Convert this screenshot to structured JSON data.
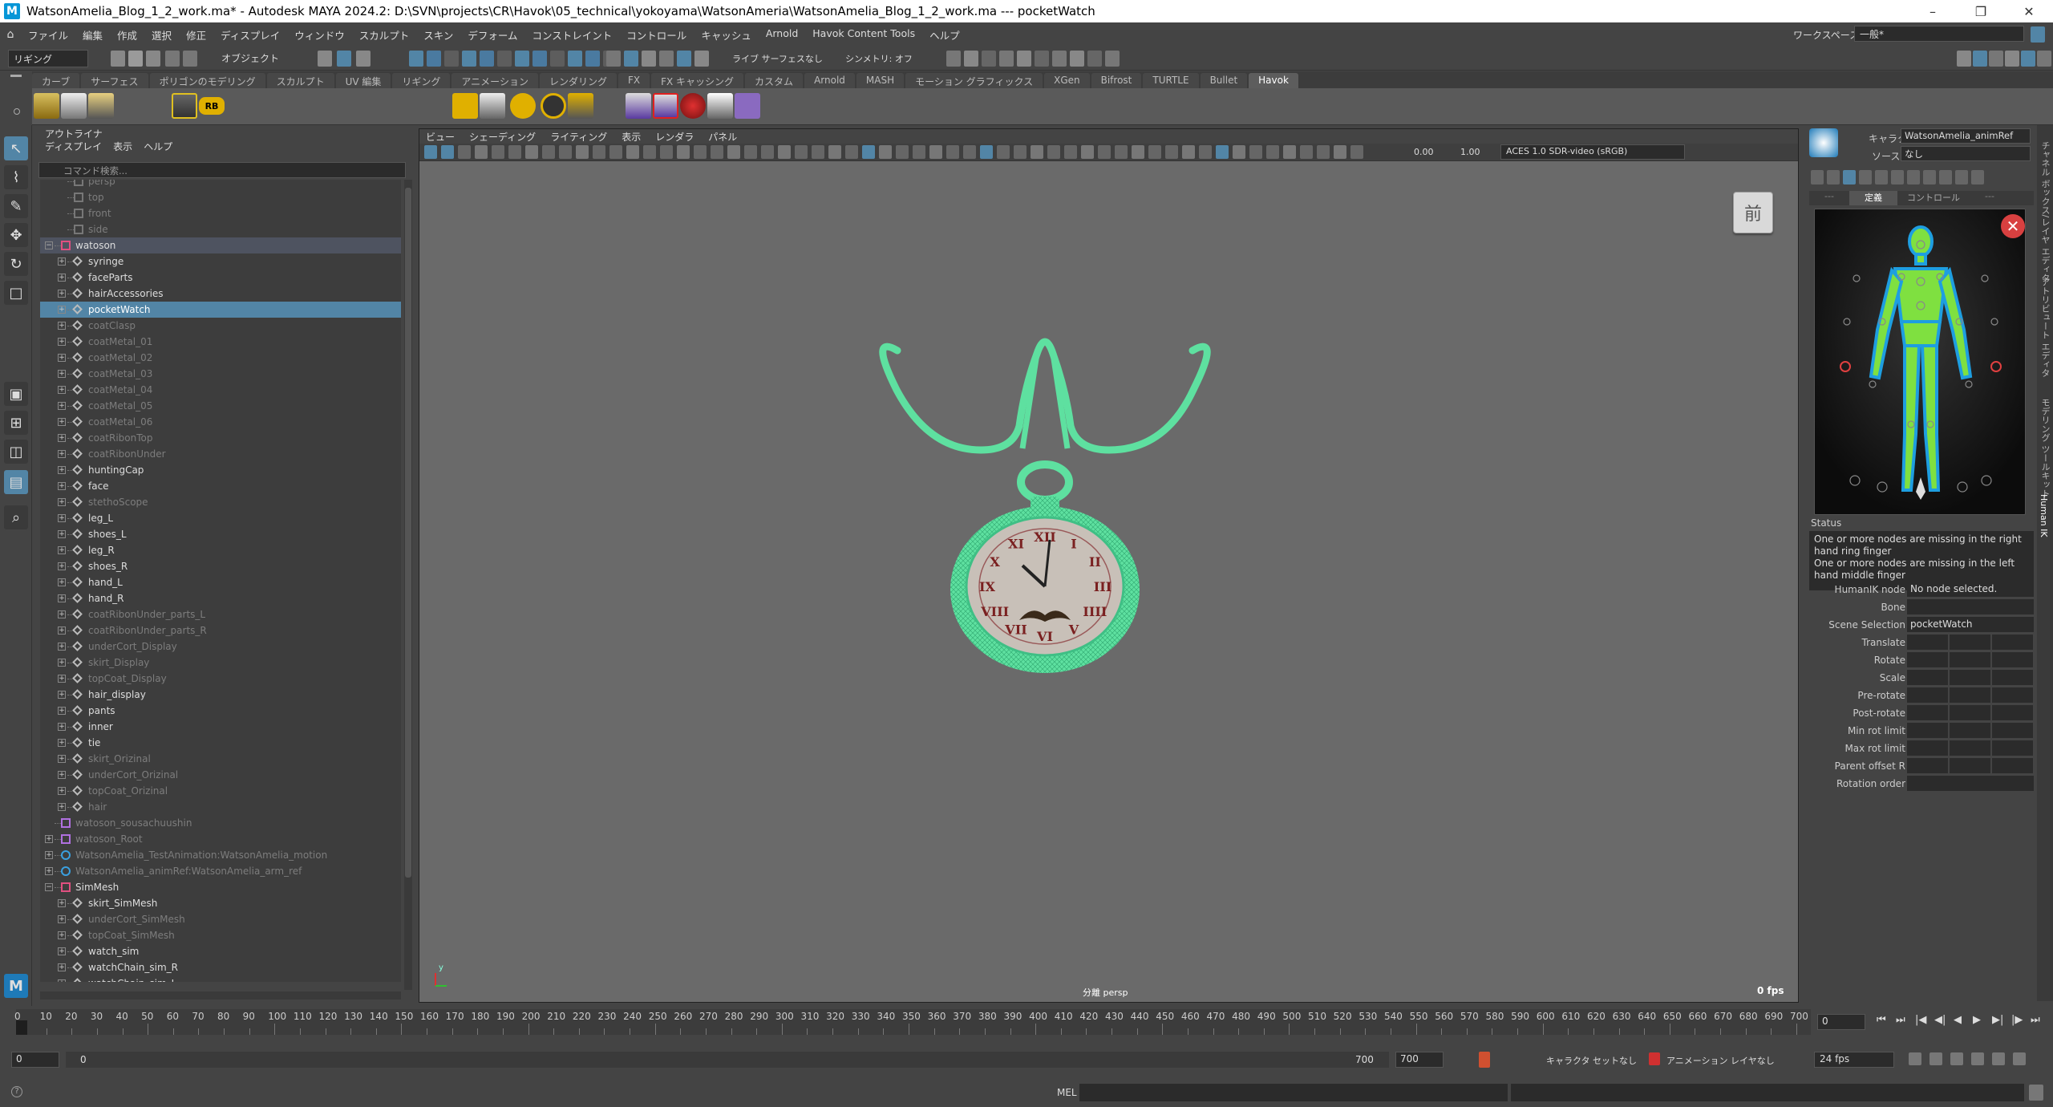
{
  "title_bar": {
    "text": "WatsonAmelia_Blog_1_2_work.ma* - Autodesk MAYA 2024.2: D:\\SVN\\projects\\CR\\Havok\\05_technical\\yokoyama\\WatsonAmeria\\WatsonAmelia_Blog_1_2_work.ma  ---  pocketWatch",
    "app_logo": "M",
    "minimize": "–",
    "restore": "❐",
    "close": "✕"
  },
  "menus": [
    "ファイル",
    "編集",
    "作成",
    "選択",
    "修正",
    "ディスプレイ",
    "ウィンドウ",
    "スカルプト",
    "スキン",
    "デフォーム",
    "コンストレイント",
    "コントロール",
    "キャッシュ",
    "Arnold",
    "Havok Content Tools",
    "ヘルプ"
  ],
  "workspace": {
    "label": "ワークスペース:",
    "value": "一般*"
  },
  "status_line": {
    "menuset": "リギング",
    "mode": "オブジェクト",
    "live": "ライブ サーフェスなし",
    "symmetry": "シンメトリ: オフ"
  },
  "shelf_tabs": [
    "カーブ",
    "サーフェス",
    "ポリゴンのモデリング",
    "スカルプト",
    "UV 編集",
    "リギング",
    "アニメーション",
    "レンダリング",
    "FX",
    "FX キャッシング",
    "カスタム",
    "Arnold",
    "MASH",
    "モーション グラフィックス",
    "XGen",
    "Bifrost",
    "TURTLE",
    "Bullet",
    "Havok"
  ],
  "shelf_active": "Havok",
  "outliner": {
    "title": "アウトライナ",
    "menu": [
      "ディスプレイ",
      "表示",
      "ヘルプ"
    ],
    "search_placeholder": "コマンド検索...",
    "items": [
      {
        "label": "persp",
        "level": 1,
        "dim": true,
        "type": "cam"
      },
      {
        "label": "top",
        "level": 1,
        "dim": true,
        "type": "cam"
      },
      {
        "label": "front",
        "level": 1,
        "dim": true,
        "type": "cam"
      },
      {
        "label": "side",
        "level": 1,
        "dim": true,
        "type": "cam"
      },
      {
        "label": "watoson",
        "level": 0,
        "exp": "minus",
        "type": "ref",
        "group": true
      },
      {
        "label": "syringe",
        "level": 1,
        "exp": "plus",
        "type": "mesh"
      },
      {
        "label": "faceParts",
        "level": 1,
        "exp": "plus",
        "type": "mesh"
      },
      {
        "label": "hairAccessories",
        "level": 1,
        "exp": "plus",
        "type": "mesh"
      },
      {
        "label": "pocketWatch",
        "level": 1,
        "exp": "plus",
        "type": "mesh",
        "selected": true
      },
      {
        "label": "coatClasp",
        "level": 1,
        "exp": "plus",
        "type": "mesh",
        "dim": true
      },
      {
        "label": "coatMetal_01",
        "level": 1,
        "exp": "plus",
        "type": "mesh",
        "dim": true
      },
      {
        "label": "coatMetal_02",
        "level": 1,
        "exp": "plus",
        "type": "mesh",
        "dim": true
      },
      {
        "label": "coatMetal_03",
        "level": 1,
        "exp": "plus",
        "type": "mesh",
        "dim": true
      },
      {
        "label": "coatMetal_04",
        "level": 1,
        "exp": "plus",
        "type": "mesh",
        "dim": true
      },
      {
        "label": "coatMetal_05",
        "level": 1,
        "exp": "plus",
        "type": "mesh",
        "dim": true
      },
      {
        "label": "coatMetal_06",
        "level": 1,
        "exp": "plus",
        "type": "mesh",
        "dim": true
      },
      {
        "label": "coatRibonTop",
        "level": 1,
        "exp": "plus",
        "type": "mesh",
        "dim": true
      },
      {
        "label": "coatRibonUnder",
        "level": 1,
        "exp": "plus",
        "type": "mesh",
        "dim": true
      },
      {
        "label": "huntingCap",
        "level": 1,
        "exp": "plus",
        "type": "mesh"
      },
      {
        "label": "face",
        "level": 1,
        "exp": "plus",
        "type": "mesh"
      },
      {
        "label": "stethoScope",
        "level": 1,
        "exp": "plus",
        "type": "mesh",
        "dim": true
      },
      {
        "label": "leg_L",
        "level": 1,
        "exp": "plus",
        "type": "mesh"
      },
      {
        "label": "shoes_L",
        "level": 1,
        "exp": "plus",
        "type": "mesh"
      },
      {
        "label": "leg_R",
        "level": 1,
        "exp": "plus",
        "type": "mesh"
      },
      {
        "label": "shoes_R",
        "level": 1,
        "exp": "plus",
        "type": "mesh"
      },
      {
        "label": "hand_L",
        "level": 1,
        "exp": "plus",
        "type": "mesh"
      },
      {
        "label": "hand_R",
        "level": 1,
        "exp": "plus",
        "type": "mesh"
      },
      {
        "label": "coatRibonUnder_parts_L",
        "level": 1,
        "exp": "plus",
        "type": "mesh",
        "dim": true
      },
      {
        "label": "coatRibonUnder_parts_R",
        "level": 1,
        "exp": "plus",
        "type": "mesh",
        "dim": true
      },
      {
        "label": "underCort_Display",
        "level": 1,
        "exp": "plus",
        "type": "mesh",
        "dim": true
      },
      {
        "label": "skirt_Display",
        "level": 1,
        "exp": "plus",
        "type": "mesh",
        "dim": true
      },
      {
        "label": "topCoat_Display",
        "level": 1,
        "exp": "plus",
        "type": "mesh",
        "dim": true
      },
      {
        "label": "hair_display",
        "level": 1,
        "exp": "plus",
        "type": "mesh"
      },
      {
        "label": "pants",
        "level": 1,
        "exp": "plus",
        "type": "mesh"
      },
      {
        "label": "inner",
        "level": 1,
        "exp": "plus",
        "type": "mesh"
      },
      {
        "label": "tie",
        "level": 1,
        "exp": "plus",
        "type": "mesh"
      },
      {
        "label": "skirt_Orizinal",
        "level": 1,
        "exp": "plus",
        "type": "mesh",
        "dim": true
      },
      {
        "label": "underCort_Orizinal",
        "level": 1,
        "exp": "plus",
        "type": "mesh",
        "dim": true
      },
      {
        "label": "topCoat_Orizinal",
        "level": 1,
        "exp": "plus",
        "type": "mesh",
        "dim": true
      },
      {
        "label": "hair",
        "level": 1,
        "exp": "plus",
        "type": "mesh",
        "dim": true
      },
      {
        "label": "watoson_sousachuushin",
        "level": 0,
        "type": "joint",
        "dim": true
      },
      {
        "label": "watoson_Root",
        "level": 0,
        "exp": "plus",
        "type": "joint",
        "dim": true
      },
      {
        "label": "WatsonAmelia_TestAnimation:WatsonAmelia_motion",
        "level": 0,
        "exp": "plus",
        "type": "hik",
        "dim": true
      },
      {
        "label": "WatsonAmelia_animRef:WatsonAmelia_arm_ref",
        "level": 0,
        "exp": "plus",
        "type": "hik",
        "dim": true
      },
      {
        "label": "SimMesh",
        "level": 0,
        "exp": "minus",
        "type": "ref"
      },
      {
        "label": "skirt_SimMesh",
        "level": 1,
        "exp": "plus",
        "type": "mesh"
      },
      {
        "label": "underCort_SimMesh",
        "level": 1,
        "exp": "plus",
        "type": "mesh",
        "dim": true
      },
      {
        "label": "topCoat_SimMesh",
        "level": 1,
        "exp": "plus",
        "type": "mesh",
        "dim": true
      },
      {
        "label": "watch_sim",
        "level": 1,
        "exp": "plus",
        "type": "mesh"
      },
      {
        "label": "watchChain_sim_R",
        "level": 1,
        "exp": "plus",
        "type": "mesh"
      },
      {
        "label": "watchChain_sim_L",
        "level": 1,
        "exp": "plus",
        "type": "mesh"
      }
    ]
  },
  "viewport": {
    "menu": [
      "ビュー",
      "シェーディング",
      "ライティング",
      "表示",
      "レンダラ",
      "パネル"
    ],
    "value_a": "0.00",
    "value_b": "1.00",
    "colorspace": "ACES 1.0 SDR-video (sRGB)",
    "viewcube_label": "前",
    "camera_label": "分離  persp",
    "fps": "0 fps",
    "axis_label": "y"
  },
  "humanik": {
    "character_label": "キャラクタ:",
    "character_value": "WatsonAmelia_animRef",
    "source_label": "ソース:",
    "source_value": "なし",
    "tabs": [
      "定義",
      "コントロール"
    ],
    "status_title": "Status",
    "status_lines": [
      "One or more nodes are missing in the right hand ring finger",
      "One or more nodes are missing in the left hand middle finger"
    ],
    "props": [
      {
        "label": "HumanIK node",
        "value": "No node selected."
      },
      {
        "label": "Bone",
        "value": ""
      },
      {
        "label": "Scene Selection",
        "value": "pocketWatch"
      }
    ],
    "props3": [
      "Translate",
      "Rotate",
      "Scale",
      "Pre-rotate",
      "Post-rotate",
      "Min rot limit",
      "Max rot limit",
      "Parent offset R"
    ],
    "rotation_order": "Rotation order",
    "tab_strip": [
      "チャネル ボックス/レイヤ エディタ",
      "アトリビュート エディタ",
      "モデリング ツールキット",
      "Human IK"
    ]
  },
  "timeline": {
    "start": 0,
    "end": 700,
    "step": 10,
    "current": "0",
    "range_start": "0",
    "range_inner_start": "0",
    "range_inner_end": "700",
    "range_end": "700",
    "character": "キャラクタ セットなし",
    "anim_layer": "アニメーション レイヤなし",
    "fps": "24 fps"
  },
  "command_line": {
    "label": "MEL"
  },
  "colors": {
    "accent": "#5285a6",
    "mesh": "#5ee0a0",
    "bg": "#444444",
    "viewport": "#6a6a6a",
    "hik_green": "#7fe040",
    "hik_blue": "#1e9ee0"
  }
}
